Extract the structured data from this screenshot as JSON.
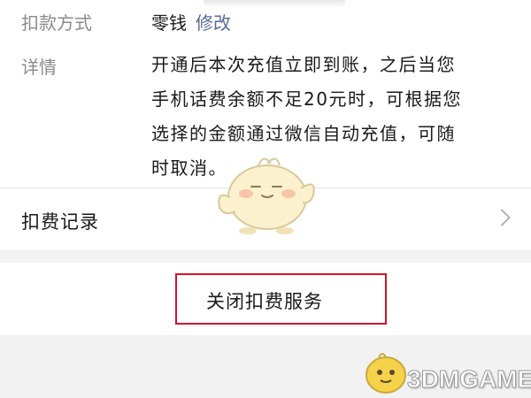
{
  "payment": {
    "label": "扣款方式",
    "value": "零钱",
    "edit_link": "修改"
  },
  "details": {
    "label": "详情",
    "lines": [
      "开通后本次充值立即到账，之后当您",
      "手机话费余额不足20元时，可根据您",
      "选择的金额通过微信自动充值，可随",
      "时取消。"
    ]
  },
  "records": {
    "label": "扣费记录",
    "chevron_icon": "chevron-right-icon"
  },
  "close_service": {
    "label": "关闭扣费服务",
    "highlight_color": "#d0132b"
  },
  "watermark": {
    "text": "3DMGAME"
  },
  "colors": {
    "link": "#576b95",
    "label_gray": "#8a8a8a",
    "page_bg": "#f2f2f2"
  }
}
